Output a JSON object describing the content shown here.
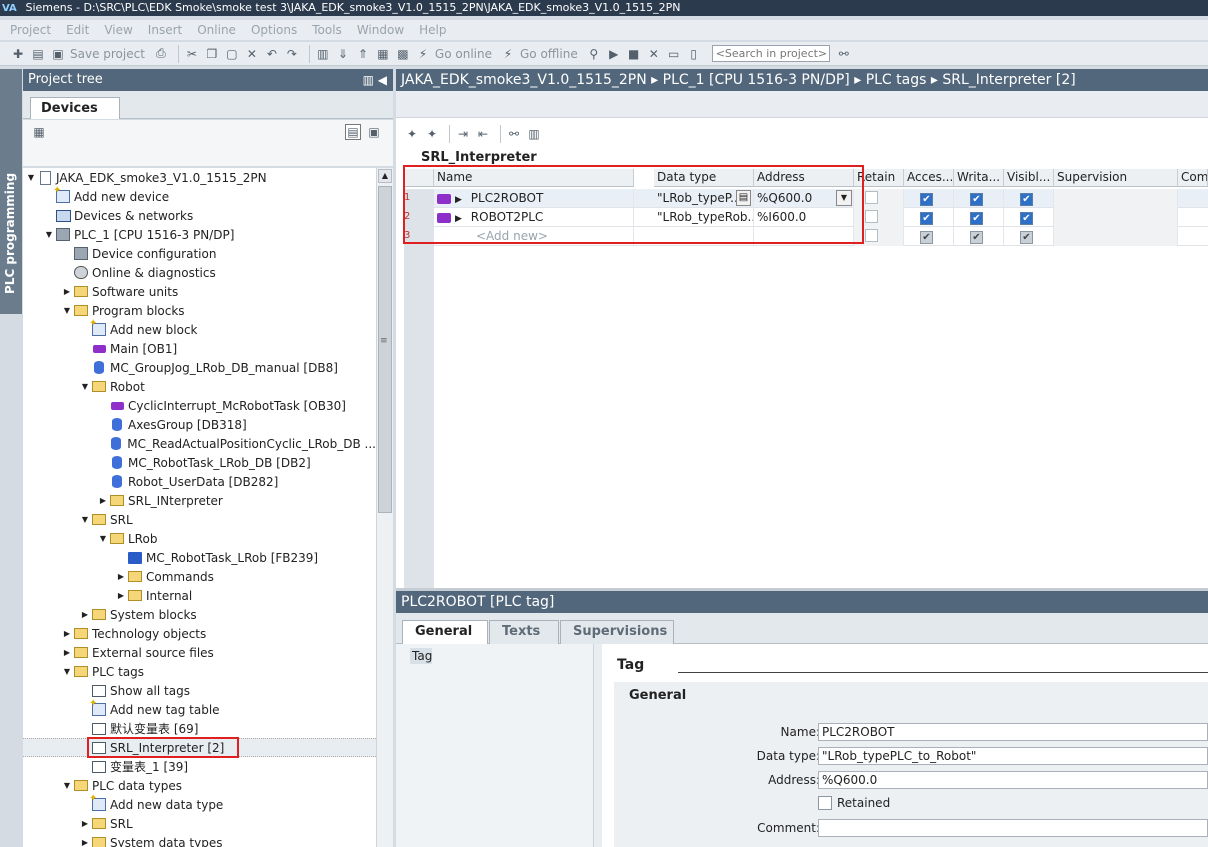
{
  "window": {
    "title": "Siemens  -  D:\\SRC\\PLC\\EDK Smoke\\smoke test 3\\JAKA_EDK_smoke3_V1.0_1515_2PN\\JAKA_EDK_smoke3_V1.0_1515_2PN"
  },
  "menu": [
    "Project",
    "Edit",
    "View",
    "Insert",
    "Online",
    "Options",
    "Tools",
    "Window",
    "Help"
  ],
  "toolbar": {
    "save_label": "Save project",
    "go_online": "Go online",
    "go_offline": "Go offline",
    "search_placeholder": "<Search in project>"
  },
  "side_tab": "PLC programming",
  "project_tree": {
    "title": "Project tree",
    "tab": "Devices",
    "items": [
      {
        "label": "JAKA_EDK_smoke3_V1.0_1515_2PN",
        "level": 0,
        "twisty": "open",
        "icon": "doc-icon"
      },
      {
        "label": "Add new device",
        "level": 1,
        "twisty": "",
        "icon": "add-icon"
      },
      {
        "label": "Devices & networks",
        "level": 1,
        "twisty": "",
        "icon": "network-icon"
      },
      {
        "label": "PLC_1 [CPU 1516-3 PN/DP]",
        "level": 1,
        "twisty": "open",
        "icon": "plc-icon"
      },
      {
        "label": "Device configuration",
        "level": 2,
        "twisty": "",
        "icon": "config-icon"
      },
      {
        "label": "Online & diagnostics",
        "level": 2,
        "twisty": "",
        "icon": "diagnostics-icon"
      },
      {
        "label": "Software units",
        "level": 2,
        "twisty": "closed",
        "icon": "folder-icon"
      },
      {
        "label": "Program blocks",
        "level": 2,
        "twisty": "open",
        "icon": "folder-icon"
      },
      {
        "label": "Add new block",
        "level": 3,
        "twisty": "",
        "icon": "add-icon"
      },
      {
        "label": "Main [OB1]",
        "level": 3,
        "twisty": "",
        "icon": "ob-icon"
      },
      {
        "label": "MC_GroupJog_LRob_DB_manual [DB8]",
        "level": 3,
        "twisty": "",
        "icon": "db-icon"
      },
      {
        "label": "Robot",
        "level": 3,
        "twisty": "open",
        "icon": "folder-icon"
      },
      {
        "label": "CyclicInterrupt_McRobotTask [OB30]",
        "level": 4,
        "twisty": "",
        "icon": "ob-icon"
      },
      {
        "label": "AxesGroup [DB318]",
        "level": 4,
        "twisty": "",
        "icon": "db-icon"
      },
      {
        "label": "MC_ReadActualPositionCyclic_LRob_DB ...",
        "level": 4,
        "twisty": "",
        "icon": "db-icon"
      },
      {
        "label": "MC_RobotTask_LRob_DB [DB2]",
        "level": 4,
        "twisty": "",
        "icon": "db-icon"
      },
      {
        "label": "Robot_UserData [DB282]",
        "level": 4,
        "twisty": "",
        "icon": "db-icon"
      },
      {
        "label": "SRL_INterpreter",
        "level": 4,
        "twisty": "closed",
        "icon": "folder-icon"
      },
      {
        "label": "SRL",
        "level": 3,
        "twisty": "open",
        "icon": "folder-icon"
      },
      {
        "label": "LRob",
        "level": 4,
        "twisty": "open",
        "icon": "folder-icon"
      },
      {
        "label": "MC_RobotTask_LRob [FB239]",
        "level": 5,
        "twisty": "",
        "icon": "fb-icon"
      },
      {
        "label": "Commands",
        "level": 5,
        "twisty": "closed",
        "icon": "folder-icon"
      },
      {
        "label": "Internal",
        "level": 5,
        "twisty": "closed",
        "icon": "folder-icon"
      },
      {
        "label": "System blocks",
        "level": 3,
        "twisty": "closed",
        "icon": "folder-icon"
      },
      {
        "label": "Technology objects",
        "level": 2,
        "twisty": "closed",
        "icon": "folder-icon"
      },
      {
        "label": "External source files",
        "level": 2,
        "twisty": "closed",
        "icon": "folder-icon"
      },
      {
        "label": "PLC tags",
        "level": 2,
        "twisty": "open",
        "icon": "folder-icon"
      },
      {
        "label": "Show all tags",
        "level": 3,
        "twisty": "",
        "icon": "tag-table-icon"
      },
      {
        "label": "Add new tag table",
        "level": 3,
        "twisty": "",
        "icon": "add-icon"
      },
      {
        "label": "默认变量表 [69]",
        "level": 3,
        "twisty": "",
        "icon": "tag-table-icon"
      },
      {
        "label": "SRL_Interpreter [2]",
        "level": 3,
        "twisty": "",
        "icon": "tag-table-icon",
        "selected": true
      },
      {
        "label": "变量表_1 [39]",
        "level": 3,
        "twisty": "",
        "icon": "tag-table-icon"
      },
      {
        "label": "PLC data types",
        "level": 2,
        "twisty": "open",
        "icon": "folder-icon"
      },
      {
        "label": "Add new data type",
        "level": 3,
        "twisty": "",
        "icon": "add-icon"
      },
      {
        "label": "SRL",
        "level": 3,
        "twisty": "closed",
        "icon": "folder-icon"
      },
      {
        "label": "System data types",
        "level": 3,
        "twisty": "closed",
        "icon": "folder-icon"
      }
    ]
  },
  "editor": {
    "breadcrumb": [
      "JAKA_EDK_smoke3_V1.0_1515_2PN",
      "PLC_1 [CPU 1516-3 PN/DP]",
      "PLC tags",
      "SRL_Interpreter [2]"
    ],
    "table_title": "SRL_Interpreter",
    "columns": [
      "Name",
      "Data type",
      "Address",
      "Retain",
      "Acces...",
      "Writa...",
      "Visibl...",
      "Supervision",
      "Com"
    ],
    "rows": [
      {
        "num": "1",
        "name": "PLC2ROBOT",
        "type": "\"LRob_typeP...",
        "address": "%Q600.0",
        "access": true,
        "write": true,
        "visible": true
      },
      {
        "num": "2",
        "name": "ROBOT2PLC",
        "type": "\"LRob_typeRob...",
        "address": "%I600.0",
        "access": true,
        "write": true,
        "visible": true
      },
      {
        "num": "3",
        "name": "<Add new>",
        "type": "",
        "address": "",
        "access": true,
        "write": true,
        "visible": true,
        "placeholder": true
      }
    ]
  },
  "properties": {
    "title": "PLC2ROBOT [PLC tag]",
    "tabs": [
      "General",
      "Texts",
      "Supervisions"
    ],
    "nav": [
      "Tag"
    ],
    "section": "Tag",
    "group": "General",
    "fields": {
      "name_label": "Name:",
      "name_value": "PLC2ROBOT",
      "type_label": "Data type:",
      "type_value": "\"LRob_typePLC_to_Robot\"",
      "address_label": "Address:",
      "address_value": "%Q600.0",
      "retained_label": "Retained",
      "comment_label": "Comment:",
      "comment_value": ""
    }
  }
}
